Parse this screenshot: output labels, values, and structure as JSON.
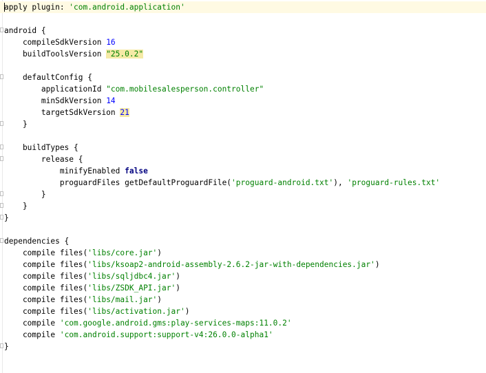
{
  "editor": {
    "file_type": "build.gradle",
    "lines": {
      "l1": {
        "a": "apply plugin: ",
        "s": "'com.android.application'"
      },
      "l3": {
        "t": "android {"
      },
      "l4": {
        "a": "    compileSdkVersion ",
        "n": "16"
      },
      "l5": {
        "a": "    buildToolsVersion ",
        "s": "\"25.0.2\""
      },
      "l7": {
        "t": "    defaultConfig {"
      },
      "l8": {
        "a": "        applicationId ",
        "s": "\"com.mobilesalesperson.controller\""
      },
      "l9": {
        "a": "        minSdkVersion ",
        "n": "14"
      },
      "l10": {
        "a": "        targetSdkVersion ",
        "n": "21"
      },
      "l11": {
        "t": "    }"
      },
      "l13": {
        "t": "    buildTypes {"
      },
      "l14": {
        "t": "        release {"
      },
      "l15": {
        "a": "            minifyEnabled ",
        "k": "false"
      },
      "l16": {
        "a": "            proguardFiles getDefaultProguardFile(",
        "s1": "'proguard-android.txt'",
        "b": "), ",
        "s2": "'proguard-rules.txt'"
      },
      "l17": {
        "t": "        }"
      },
      "l18": {
        "t": "    }"
      },
      "l19": {
        "t": "}"
      },
      "l21": {
        "t": "dependencies {"
      },
      "l22": {
        "a": "    compile files(",
        "s": "'libs/core.jar'",
        "b": ")"
      },
      "l23": {
        "a": "    compile files(",
        "s": "'libs/ksoap2-android-assembly-2.6.2-jar-with-dependencies.jar'",
        "b": ")"
      },
      "l24": {
        "a": "    compile files(",
        "s": "'libs/sqljdbc4.jar'",
        "b": ")"
      },
      "l25": {
        "a": "    compile files(",
        "s": "'libs/ZSDK_API.jar'",
        "b": ")"
      },
      "l26": {
        "a": "    compile files(",
        "s": "'libs/mail.jar'",
        "b": ")"
      },
      "l27": {
        "a": "    compile files(",
        "s": "'libs/activation.jar'",
        "b": ")"
      },
      "l28": {
        "a": "    compile ",
        "s": "'com.google.android.gms:play-services-maps:11.0.2'"
      },
      "l29": {
        "a": "    compile ",
        "s": "'com.android.support:support-v4:26.0.0-alpha1'"
      },
      "l30": {
        "t": "}"
      }
    },
    "colors": {
      "string": "#008000",
      "number": "#0000ff",
      "keyword": "#000080",
      "current_line": "#fffae3",
      "highlight": "#f5eaa6"
    }
  }
}
